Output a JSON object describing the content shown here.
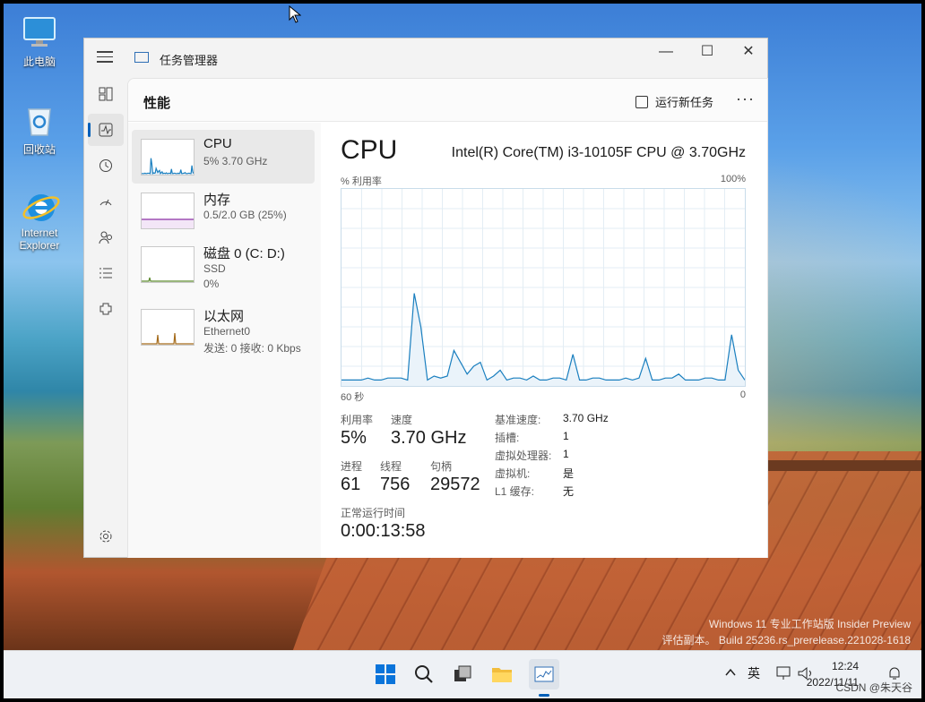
{
  "desktop": {
    "icons": [
      {
        "label": "此电脑"
      },
      {
        "label": "回收站"
      },
      {
        "label": "Internet Explorer"
      }
    ],
    "watermark": {
      "line1": "Windows 11 专业工作站版 Insider Preview",
      "line2": "评估副本。 Build 25236.rs_prerelease.221028-1618"
    }
  },
  "window": {
    "title": "任务管理器",
    "controls": {
      "minimize": "—",
      "maximize": "☐",
      "close": "✕"
    }
  },
  "header": {
    "page_title": "性能",
    "run_task_label": "运行新任务",
    "more_label": "···"
  },
  "resources": [
    {
      "name": "CPU",
      "sub1": "5% 3.70 GHz",
      "sub2": ""
    },
    {
      "name": "内存",
      "sub1": "0.5/2.0 GB (25%)",
      "sub2": ""
    },
    {
      "name": "磁盘 0 (C: D:)",
      "sub1": "SSD",
      "sub2": "0%"
    },
    {
      "name": "以太网",
      "sub1": "Ethernet0",
      "sub2": "发送: 0 接收: 0 Kbps"
    }
  ],
  "detail": {
    "title": "CPU",
    "processor": "Intel(R) Core(TM) i3-10105F CPU @ 3.70GHz",
    "graph_label_left": "% 利用率",
    "graph_label_right": "100%",
    "graph_axis_left": "60 秒",
    "graph_axis_right": "0",
    "stats": {
      "util_label": "利用率",
      "util_value": "5%",
      "speed_label": "速度",
      "speed_value": "3.70 GHz",
      "proc_label": "进程",
      "proc_value": "61",
      "thread_label": "线程",
      "thread_value": "756",
      "handle_label": "句柄",
      "handle_value": "29572",
      "uptime_label": "正常运行时间",
      "uptime_value": "0:00:13:58"
    },
    "specs": [
      {
        "k": "基准速度:",
        "v": "3.70 GHz"
      },
      {
        "k": "插槽:",
        "v": "1"
      },
      {
        "k": "虚拟处理器:",
        "v": "1"
      },
      {
        "k": "虚拟机:",
        "v": "是"
      },
      {
        "k": "L1 缓存:",
        "v": "无"
      }
    ]
  },
  "cpu_history": [
    3,
    3,
    3,
    3,
    4,
    3,
    3,
    4,
    4,
    4,
    3,
    47,
    30,
    3,
    5,
    4,
    5,
    18,
    12,
    6,
    10,
    12,
    3,
    5,
    8,
    3,
    4,
    4,
    3,
    5,
    3,
    3,
    4,
    4,
    3,
    16,
    3,
    3,
    4,
    4,
    3,
    3,
    3,
    4,
    3,
    4,
    14,
    3,
    3,
    4,
    4,
    6,
    3,
    3,
    3,
    4,
    4,
    3,
    3,
    26,
    8,
    3
  ],
  "taskbar": {
    "tray_lang": "英",
    "time": "12:24",
    "date": "2022/11/11",
    "credit": "CSDN @朱天谷"
  },
  "colors": {
    "accent": "#005fb8",
    "cpu_line": "#1a7fbf",
    "mem_line": "#8b2fa5",
    "disk_line": "#5c8a2e",
    "net_line": "#a46a1a"
  }
}
